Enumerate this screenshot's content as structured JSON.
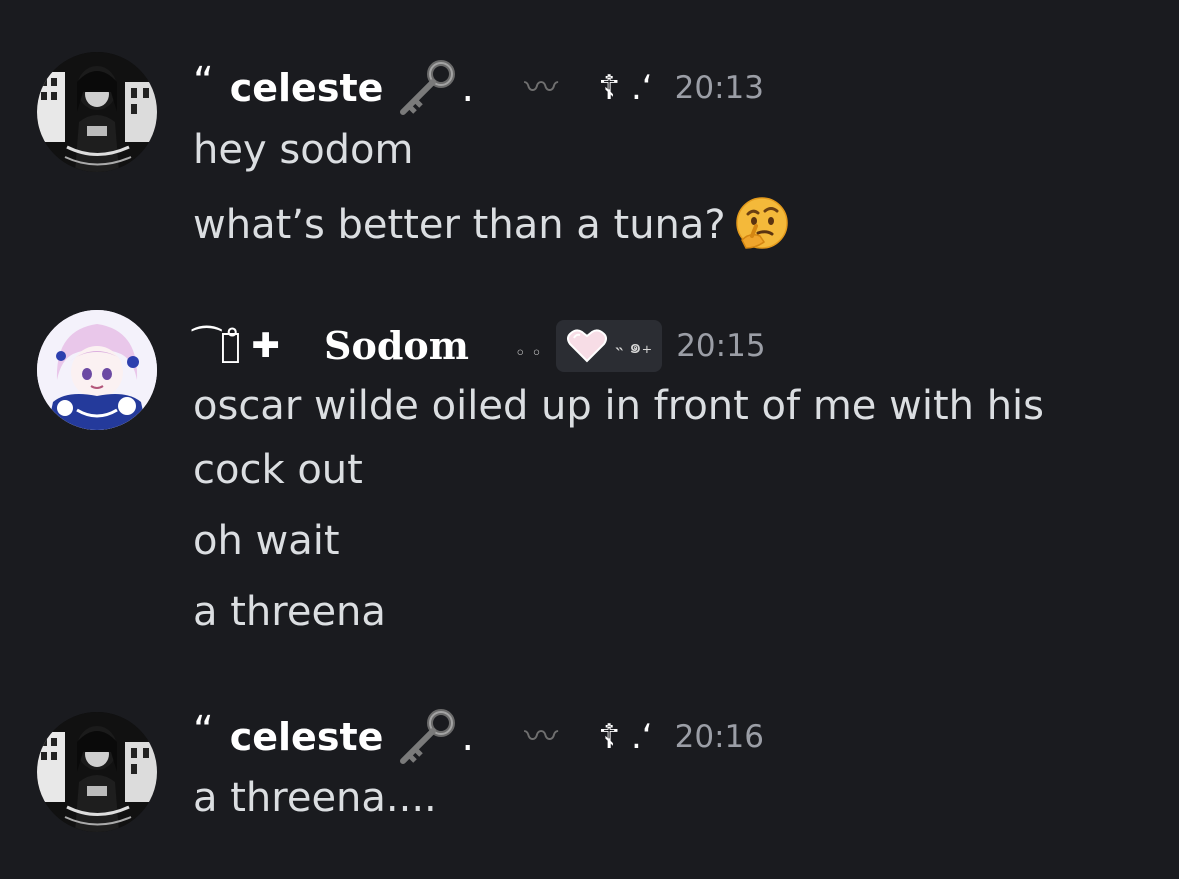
{
  "messages": [
    {
      "author_prefix": "“",
      "author": "celeste",
      "key_icon": "key-icon",
      "author_suffix_1": ".",
      "author_suffix_2": "〰",
      "author_suffix_3": "☦ .‘",
      "time": "20:13",
      "lines": [
        "hey sodom",
        "what’s better than a tuna?"
      ],
      "emoji": "thinking-face-icon"
    },
    {
      "author_prefix": "⁀꒱̊ ✚",
      "author": "Sodom",
      "author_suffix_1": "◦ ◦",
      "badge_icon": "pink-heart-icon",
      "badge_text": "˵  ๑₊",
      "time": "20:15",
      "lines": [
        "oscar wilde oiled up in front of me with his",
        "cock out",
        "oh wait",
        "a threena"
      ]
    },
    {
      "author_prefix": "“",
      "author": "celeste",
      "key_icon": "key-icon",
      "author_suffix_1": ".",
      "author_suffix_2": "〰",
      "author_suffix_3": "☦ .‘",
      "time": "20:16",
      "lines": [
        "a threena...."
      ]
    }
  ],
  "colors": {
    "background": "#1a1b1f",
    "text": "#dbdee1",
    "username": "#ffffff",
    "timestamp": "#9b9ea6",
    "badge_bg": "#2b2d33"
  }
}
